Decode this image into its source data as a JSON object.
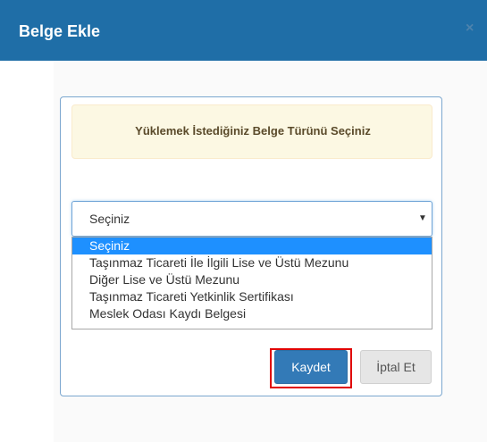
{
  "modal": {
    "title": "Belge Ekle",
    "close_label": "×"
  },
  "alert": {
    "text": "Yüklemek İstediğiniz Belge Türünü Seçiniz"
  },
  "select": {
    "value": "Seçiniz",
    "arrow": "▼",
    "options": [
      "Seçiniz",
      "Taşınmaz Ticareti İle İlgili Lise ve Üstü Mezunu",
      "Diğer Lise ve Üstü Mezunu",
      "Taşınmaz Ticareti Yetkinlik Sertifikası",
      "Meslek Odası Kaydı Belgesi"
    ],
    "selected_index": 0
  },
  "buttons": {
    "save_label": "Kaydet",
    "cancel_label": "İptal Et"
  },
  "colors": {
    "header": "#1f6ea7",
    "primary": "#337ab7",
    "highlight": "#e00000",
    "option_selected": "#1e90ff",
    "alert_bg": "#fcf8e3"
  }
}
